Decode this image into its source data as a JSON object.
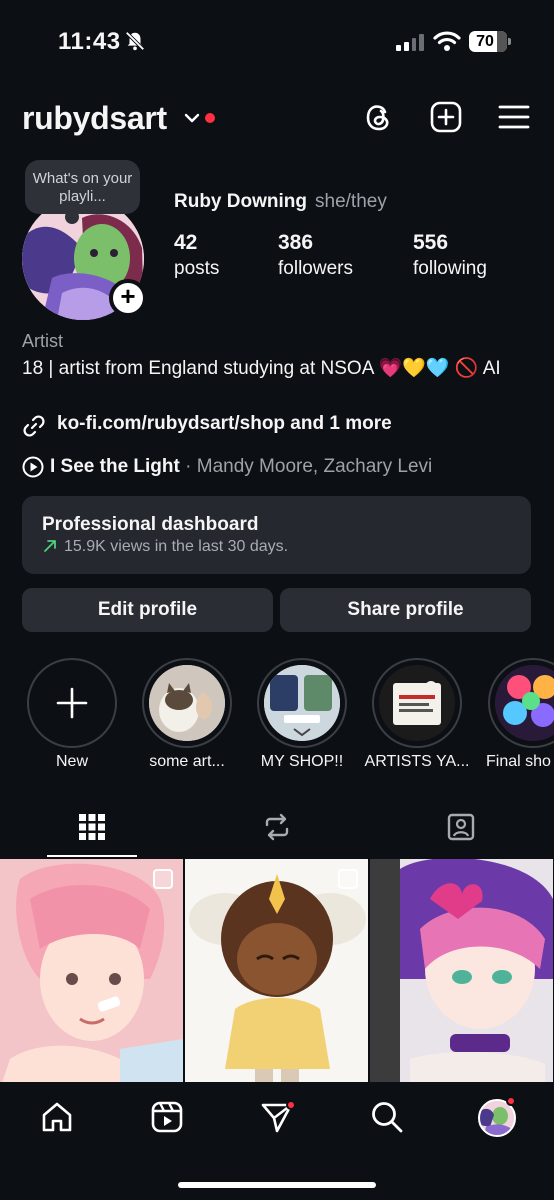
{
  "status_bar": {
    "time": "11:43",
    "battery": "70"
  },
  "header": {
    "username": "rubydsart"
  },
  "note": {
    "text": "What's on your playli..."
  },
  "profile": {
    "full_name": "Ruby Downing",
    "pronouns": "she/they",
    "stats": [
      {
        "value": "42",
        "label": "posts"
      },
      {
        "value": "386",
        "label": "followers"
      },
      {
        "value": "556",
        "label": "following"
      }
    ],
    "category": "Artist",
    "bio": "18 | artist from England studying at NSOA 💗💛🩵 🚫 AI",
    "link": "ko-fi.com/rubydsart/shop and 1 more",
    "music": {
      "title": "I See the Light",
      "separator": " · ",
      "artist": "Mandy Moore, Zachary Levi"
    }
  },
  "dashboard": {
    "title": "Professional dashboard",
    "subtitle": "15.9K views in the last 30 days."
  },
  "buttons": {
    "edit": "Edit profile",
    "share": "Share profile"
  },
  "highlights": [
    {
      "label": "New"
    },
    {
      "label": "some art..."
    },
    {
      "label": "MY SHOP!!"
    },
    {
      "label": "ARTISTS YA..."
    },
    {
      "label": "Final sho"
    }
  ],
  "tabs": [
    "grid-icon",
    "reels-repost-icon",
    "tagged-icon"
  ],
  "colors": {
    "background": "#0c0f14",
    "accent_red": "#ff3040",
    "card": "#25282e"
  }
}
